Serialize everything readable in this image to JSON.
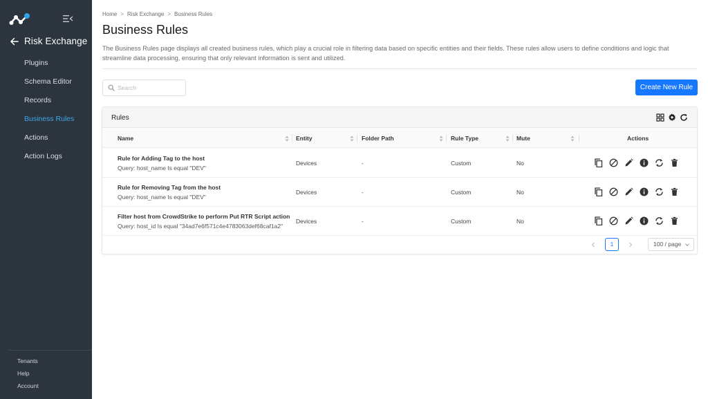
{
  "sidebar": {
    "app_title": "Risk Exchange",
    "items": [
      {
        "label": "Plugins"
      },
      {
        "label": "Schema Editor"
      },
      {
        "label": "Records"
      },
      {
        "label": "Business Rules",
        "active": true
      },
      {
        "label": "Actions"
      },
      {
        "label": "Action Logs"
      }
    ],
    "footer": [
      {
        "label": "Tenants"
      },
      {
        "label": "Help"
      },
      {
        "label": "Account"
      }
    ]
  },
  "breadcrumb": [
    "Home",
    "Risk Exchange",
    "Business Rules"
  ],
  "page": {
    "title": "Business Rules",
    "description": "The Business Rules page displays all created business rules, which play a crucial role in filtering data based on specific entities and their fields. These rules allow users to define conditions and logic that streamline data processing, ensuring that only relevant information is sent and utilized."
  },
  "search": {
    "placeholder": "Search",
    "value": ""
  },
  "create_button": {
    "label": "Create New Rule"
  },
  "colors": {
    "accent": "#1677ff",
    "sidebar_bg": "#2c353e",
    "active_nav": "#3ba7e8"
  },
  "card": {
    "title": "Rules",
    "tools": [
      "grid-icon",
      "gear-icon",
      "refresh-icon"
    ]
  },
  "table": {
    "columns": {
      "name": "Name",
      "entity": "Entity",
      "folder_path": "Folder Path",
      "rule_type": "Rule Type",
      "mute": "Mute",
      "actions": "Actions"
    },
    "rows": [
      {
        "name": "Rule for Adding Tag to the host",
        "query": "Query: host_name Is equal \"DEV\"",
        "entity": "Devices",
        "folder_path": "-",
        "rule_type": "Custom",
        "mute": "No"
      },
      {
        "name": "Rule for Removing Tag from the host",
        "query": "Query: host_name Is equal \"DEV\"",
        "entity": "Devices",
        "folder_path": "-",
        "rule_type": "Custom",
        "mute": "No"
      },
      {
        "name": "Filter host from CrowdStrike to perform Put RTR Script action",
        "query": "Query: host_id Is equal \"34ad7e6f571c4e4783063def68caf1a2\"",
        "entity": "Devices",
        "folder_path": "-",
        "rule_type": "Custom",
        "mute": "No"
      }
    ],
    "row_actions": [
      "copy-icon",
      "mute-icon",
      "edit-icon",
      "info-icon",
      "sync-icon",
      "delete-icon"
    ]
  },
  "pagination": {
    "current_page": "1",
    "page_size": "100 / page"
  }
}
